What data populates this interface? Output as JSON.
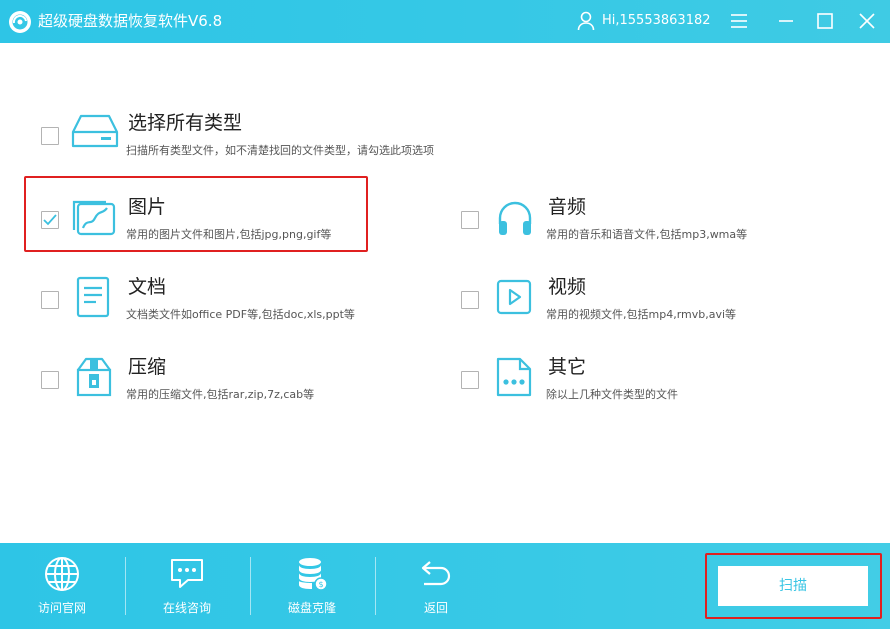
{
  "titlebar": {
    "app_title": "超级硬盘数据恢复软件V6.8",
    "user": "Hi,15553863182",
    "icons": [
      "app-logo-icon",
      "user-icon",
      "menu-icon",
      "minimize-icon",
      "maximize-icon",
      "close-icon"
    ]
  },
  "options": {
    "all_types": {
      "title": "选择所有类型",
      "desc": "扫描所有类型文件，如不清楚找回的文件类型，请勾选此项选项",
      "checked": false,
      "icon": "hard-drive-icon"
    },
    "image": {
      "title": "图片",
      "desc": "常用的图片文件和图片,包括jpg,png,gif等",
      "checked": true,
      "icon": "image-icon"
    },
    "audio": {
      "title": "音频",
      "desc": "常用的音乐和语音文件,包括mp3,wma等",
      "checked": false,
      "icon": "headphones-icon"
    },
    "document": {
      "title": "文档",
      "desc": "文档类文件如office PDF等,包括doc,xls,ppt等",
      "checked": false,
      "icon": "document-icon"
    },
    "video": {
      "title": "视频",
      "desc": "常用的视频文件,包括mp4,rmvb,avi等",
      "checked": false,
      "icon": "video-icon"
    },
    "archive": {
      "title": "压缩",
      "desc": "常用的压缩文件,包括rar,zip,7z,cab等",
      "checked": false,
      "icon": "archive-icon"
    },
    "other": {
      "title": "其它",
      "desc": "除以上几种文件类型的文件",
      "checked": false,
      "icon": "other-file-icon"
    }
  },
  "bottombar": {
    "visit_site": "访问官网",
    "online_consult": "在线咨询",
    "disk_clone": "磁盘克隆",
    "back": "返回",
    "scan": "扫描"
  },
  "colors": {
    "accent": "#35c8e6",
    "icon": "#3cc0df",
    "highlight": "#e02020"
  }
}
